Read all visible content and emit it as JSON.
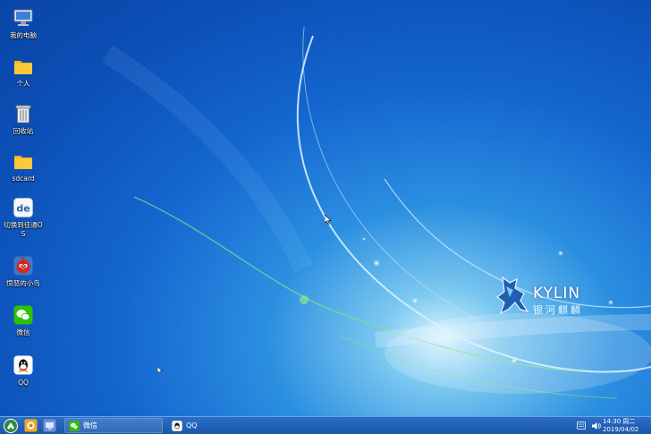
{
  "desktop_icons": [
    {
      "label": "我的电脑",
      "icon": "computer-icon"
    },
    {
      "label": "个人",
      "icon": "folder-icon"
    },
    {
      "label": "回收站",
      "icon": "trash-icon"
    },
    {
      "label": "sdcard",
      "icon": "folder-icon"
    },
    {
      "label": "切换到佳通OS",
      "icon": "switch-os-icon"
    },
    {
      "label": "愤怒的小鸟",
      "icon": "angry-birds-icon"
    },
    {
      "label": "微信",
      "icon": "wechat-icon"
    },
    {
      "label": "QQ",
      "icon": "qq-icon"
    }
  ],
  "logo": {
    "brand": "KYLIN",
    "subtitle": "银河麒麟"
  },
  "taskbar": {
    "tasks": [
      {
        "label": "微信",
        "icon": "wechat-icon",
        "active": true
      },
      {
        "label": "QQ",
        "icon": "qq-icon",
        "active": false
      }
    ],
    "clock": {
      "time": "14:30 周二",
      "date": "2019/04/02"
    }
  },
  "colors": {
    "taskbar": "#1f5fb5",
    "wechat": "#2dc100",
    "folder": "#f5b21a"
  }
}
